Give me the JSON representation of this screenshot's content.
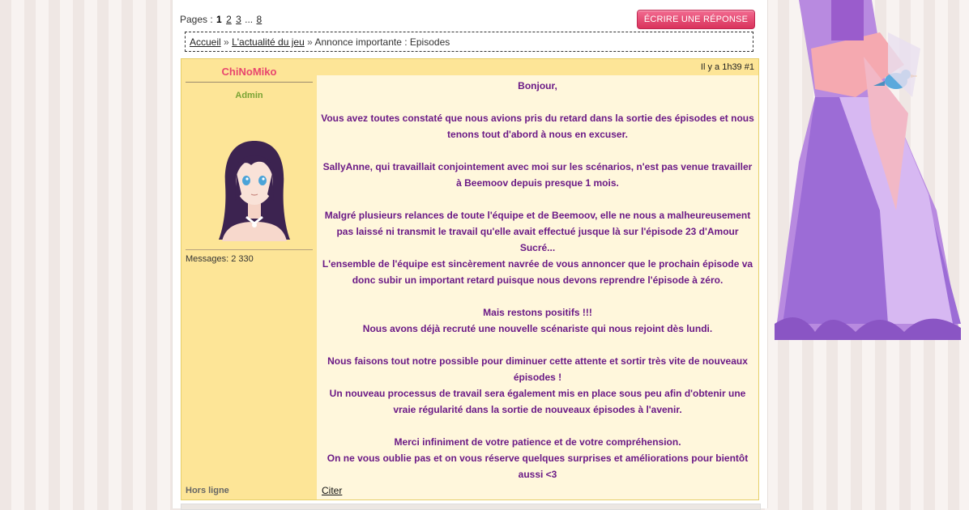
{
  "pagination": {
    "label": "Pages :",
    "current": "1",
    "pages": [
      "2",
      "3"
    ],
    "ellipsis": "...",
    "last": "8"
  },
  "reply_button": {
    "label": "ÉCRIRE UNE RÉPONSE"
  },
  "breadcrumb": {
    "home": "Accueil",
    "sep1": "»",
    "forum": "L'actualité du jeu",
    "sep2": "»",
    "current": "Annonce importante : Episodes"
  },
  "post": {
    "author": "ChiNoMiko",
    "rank": "Admin",
    "messages_label": "Messages: 2 330",
    "status": "Hors ligne",
    "time": "Il y a 1h39",
    "number": "#1",
    "lines": [
      "Bonjour,",
      "",
      "Vous avez toutes constaté que nous avions pris du retard dans la sortie des épisodes et nous tenons tout d'abord à nous en excuser.",
      "",
      "SallyAnne, qui travaillait conjointement avec moi sur les scénarios, n'est pas venue travailler à Beemoov depuis presque 1 mois.",
      "",
      "Malgré plusieurs relances de toute l'équipe et de Beemoov, elle ne nous a malheureusement pas laissé ni transmit le travail qu'elle avait effectué jusque là sur l'épisode 23 d'Amour Sucré...",
      "L'ensemble de l'équipe est sincèrement navrée de vous annoncer que le prochain épisode va donc subir un important retard puisque nous devons reprendre l'épisode à zéro.",
      "",
      "Mais restons positifs !!!",
      "Nous avons déjà recruté une nouvelle scénariste qui nous rejoint dès lundi.",
      "",
      "Nous faisons tout notre possible pour diminuer cette attente et sortir très vite de nouveaux épisodes !",
      "Un nouveau processus de travail sera également mis en place sous peu afin d'obtenir une vraie régularité dans la sortie de nouveaux épisodes à l'avenir.",
      "",
      "Merci infiniment de votre patience et de votre compréhension.",
      "On ne vous oublie pas et on vous réserve quelques surprises et améliorations pour bientôt aussi <3"
    ],
    "quote_label": "Citer"
  },
  "colors": {
    "author_name": "#e8466e",
    "rank": "#79a334",
    "post_text": "#6b1a86",
    "author_bg": "#fde597",
    "body_bg": "#fff7dc",
    "button": "#d9335c"
  }
}
